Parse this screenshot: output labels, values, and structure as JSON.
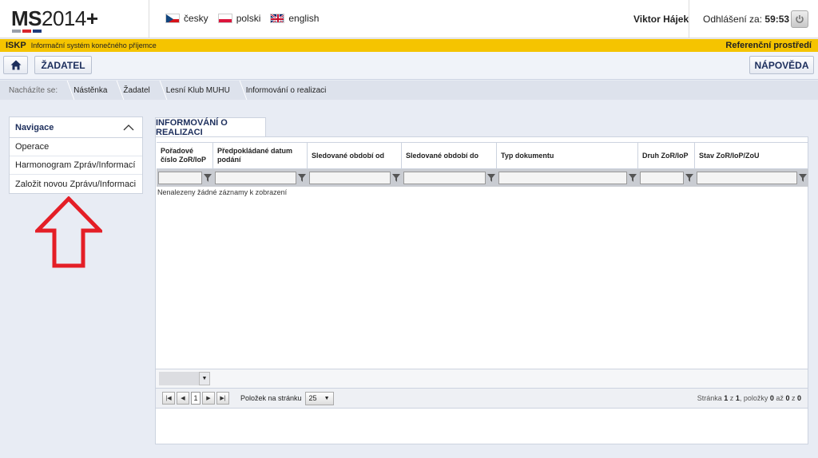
{
  "header": {
    "logo": {
      "bold": "MS",
      "thin": "2014",
      "plus": "+"
    },
    "languages": [
      {
        "label": "česky",
        "icon": "flag-cz-icon"
      },
      {
        "label": "polski",
        "icon": "flag-pl-icon"
      },
      {
        "label": "english",
        "icon": "flag-uk-icon"
      }
    ],
    "user": "Viktor Hájek",
    "logout_label": "Odhlášení za:",
    "logout_time": "59:53"
  },
  "system_bar": {
    "code": "ISKP",
    "name": "Informační systém konečného příjemce",
    "environment": "Referenční prostředí"
  },
  "toolbar": {
    "home_icon": "home-icon",
    "zadatel_label": "ŽADATEL",
    "help_label": "NÁPOVĚDA"
  },
  "breadcrumb": {
    "label": "Nacházíte se:",
    "items": [
      "Nástěnka",
      "Žadatel",
      "Lesní Klub MUHU",
      "Informování o realizaci"
    ]
  },
  "navigation": {
    "title": "Navigace",
    "items": [
      "Operace",
      "Harmonogram Zpráv/Informací",
      "Založit novou Zprávu/Informaci"
    ]
  },
  "main": {
    "tab_label": "INFORMOVÁNÍ O REALIZACI",
    "columns": [
      "Pořadové číslo ZoR/IoP",
      "Předpokládané datum podání",
      "Sledované období od",
      "Sledované období do",
      "Typ dokumentu",
      "Druh ZoR/IoP",
      "Stav ZoR/IoP/ZoU"
    ],
    "empty_message": "Nenalezeny žádné záznamy k zobrazení",
    "pager": {
      "page": "1",
      "per_page_label": "Položek na stránku",
      "per_page": "25",
      "info_page_label": "Stránka",
      "info_page": "1",
      "info_of": "z",
      "info_pages": "1",
      "info_items_label": ", položky",
      "info_from": "0",
      "info_to_label": "až",
      "info_to": "0",
      "info_total_label": "z",
      "info_total": "0"
    }
  },
  "colors": {
    "accent_navy": "#1c2e5c",
    "yellow_bar": "#f5c400",
    "arrow_red": "#e41e26"
  }
}
